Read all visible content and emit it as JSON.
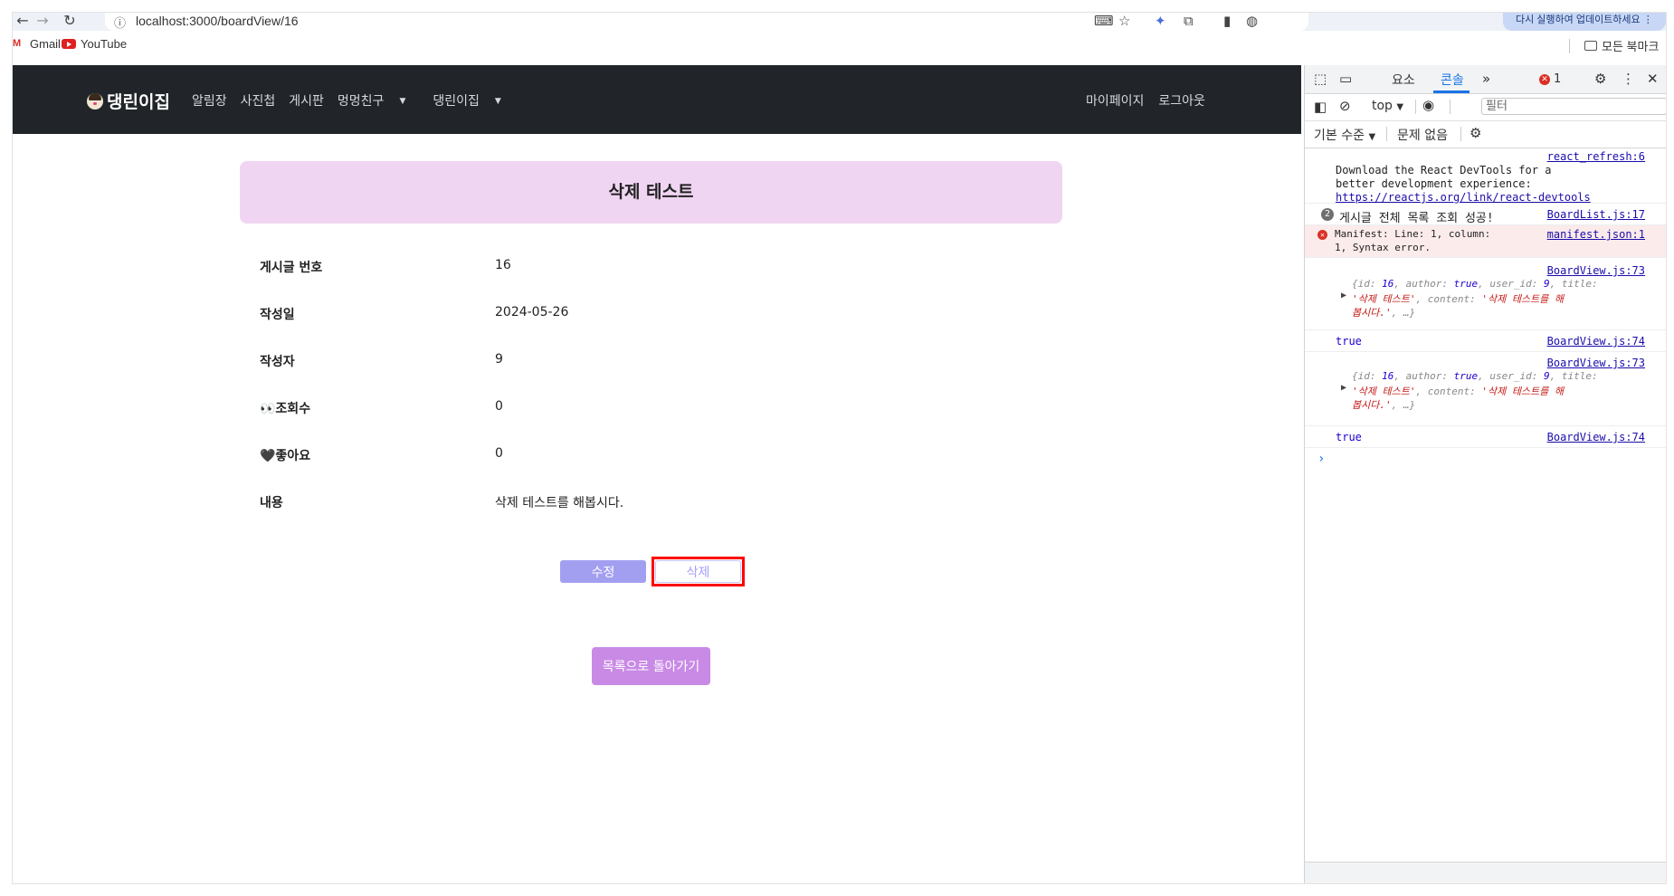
{
  "browser": {
    "url": "localhost:3000/boardView/16",
    "update_label": "다시 실행하여 업데이트하세요",
    "bookmarks": [
      {
        "label": "Gmail"
      },
      {
        "label": "YouTube"
      }
    ],
    "all_bookmarks_label": "모든 북마크"
  },
  "app": {
    "brand": "댕린이집",
    "menu": [
      "알림장",
      "사진첩",
      "게시판",
      "멍멍친구",
      "댕린이집"
    ],
    "right_menu": [
      "마이페이지",
      "로그아웃"
    ]
  },
  "post": {
    "title": "삭제 테스트",
    "fields": [
      {
        "label": "게시글 번호",
        "value": "16"
      },
      {
        "label": "작성일",
        "value": "2024-05-26"
      },
      {
        "label": "작성자",
        "value": "9"
      },
      {
        "label": "👀조회수",
        "value": "0"
      },
      {
        "label": "🖤좋아요",
        "value": "0"
      },
      {
        "label": "내용",
        "value": "삭제 테스트를 해봅시다."
      }
    ],
    "edit_label": "수정",
    "delete_label": "삭제",
    "back_label": "목록으로 돌아가기"
  },
  "devtools": {
    "tabs": [
      "요소",
      "콘솔"
    ],
    "active_tab": "콘솔",
    "error_count": "1",
    "context": "top",
    "filter_placeholder": "필터",
    "level_label": "기본 수준",
    "issues_label": "문제 없음",
    "messages": {
      "m1_src": "react_refresh:6",
      "m1_l1": "Download the React DevTools for a",
      "m1_l2": "better development experience:",
      "m1_link": "https://reactjs.org/link/react-devtools",
      "m2_count": "2",
      "m2_text": "게시글 전체 목록 조회 성공!",
      "m2_src": "BoardList.js:17",
      "m3_l1": "Manifest: Line: 1, column:",
      "m3_l2": "1, Syntax error.",
      "m3_src": "manifest.json:1",
      "m4_src": "BoardView.js:73",
      "m5_text": "true",
      "m5_src": "BoardView.js:74",
      "m6_src": "BoardView.js:73",
      "m7_text": "true",
      "m7_src": "BoardView.js:74"
    },
    "colors": {
      "active": "#1a73e8",
      "error": "#d93025"
    }
  }
}
